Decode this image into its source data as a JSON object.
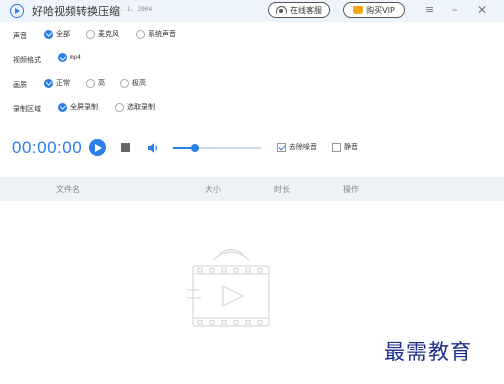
{
  "titlebar": {
    "title": "好哈视频转换压缩",
    "version": "1. 1. 2004",
    "service_label": "在线客服",
    "buy_label": "购买VIP",
    "menu_glyph": "≡",
    "min_glyph": "–",
    "close_glyph": "✕"
  },
  "settings": {
    "audio": {
      "label": "声音",
      "options": [
        "全部",
        "麦克风",
        "系统声音"
      ],
      "selected": "全部"
    },
    "format": {
      "label": "视频格式",
      "options": [
        "mp4"
      ],
      "selected": "mp4"
    },
    "quality": {
      "label": "画质",
      "options": [
        "正常",
        "高",
        "极高"
      ],
      "selected": "正常"
    },
    "region": {
      "label": "录制区域",
      "options": [
        "全屏录制",
        "选取录制"
      ],
      "selected": "全屏录制"
    }
  },
  "controls": {
    "timer": "00:00:00",
    "volume_level": 0.25,
    "denoise_label": "去除噪音",
    "denoise_checked": true,
    "mute_label": "静音",
    "mute_checked": false
  },
  "table": {
    "columns": [
      "文件名",
      "大小",
      "时长",
      "操作"
    ]
  },
  "watermark": "最需教育",
  "colors": {
    "accent": "#2b7de9",
    "titlebar_bg": "#eef4fb",
    "table_header_bg": "#eef1f5",
    "buy_icon": "#f3a514",
    "watermark": "#1f2f8f"
  },
  "icons": {
    "logo": "play-circle-icon",
    "service": "headset-icon",
    "buy": "cart-icon",
    "volume": "speaker-icon",
    "empty": "video-file-icon"
  }
}
